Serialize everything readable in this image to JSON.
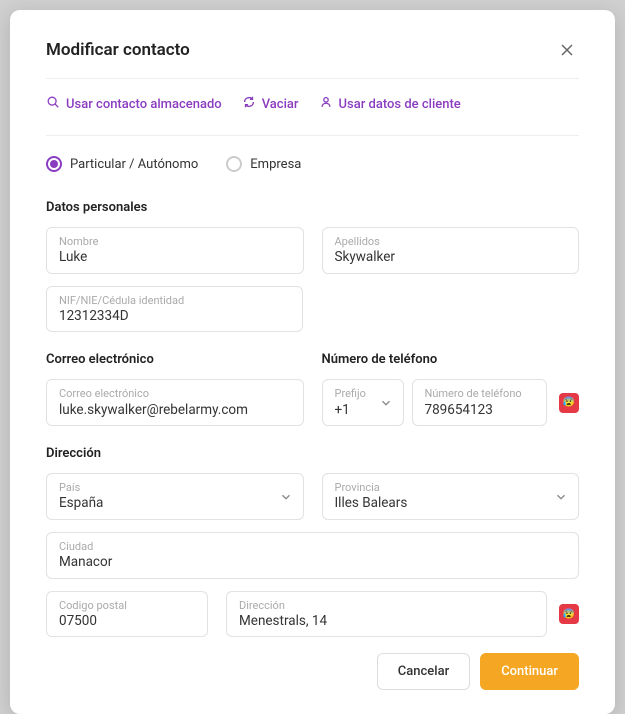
{
  "header": {
    "title": "Modificar contacto"
  },
  "actions": {
    "stored": "Usar contacto almacenado",
    "empty": "Vaciar",
    "client": "Usar datos de cliente"
  },
  "radios": {
    "individual": "Particular / Autónomo",
    "company": "Empresa"
  },
  "sections": {
    "personal": "Datos personales",
    "email": "Correo electrónico",
    "phone": "Número de teléfono",
    "address": "Dirección"
  },
  "fields": {
    "name": {
      "label": "Nombre",
      "value": "Luke"
    },
    "surname": {
      "label": "Apellidos",
      "value": "Skywalker"
    },
    "nif": {
      "label": "NIF/NIE/Cédula identidad",
      "value": "12312334D"
    },
    "email": {
      "label": "Correo electrónico",
      "value": "luke.skywalker@rebelarmy.com"
    },
    "prefix": {
      "label": "Prefijo",
      "value": "+1"
    },
    "phone": {
      "label": "Número de teléfono",
      "value": "789654123"
    },
    "country": {
      "label": "País",
      "value": "España"
    },
    "province": {
      "label": "Provincia",
      "value": "Illes Balears"
    },
    "city": {
      "label": "Ciudad",
      "value": "Manacor"
    },
    "postal": {
      "label": "Codigo postal",
      "value": "07500"
    },
    "street": {
      "label": "Dirección",
      "value": "Menestrals, 14"
    }
  },
  "buttons": {
    "cancel": "Cancelar",
    "continue": "Continuar"
  },
  "emoji": "😰"
}
